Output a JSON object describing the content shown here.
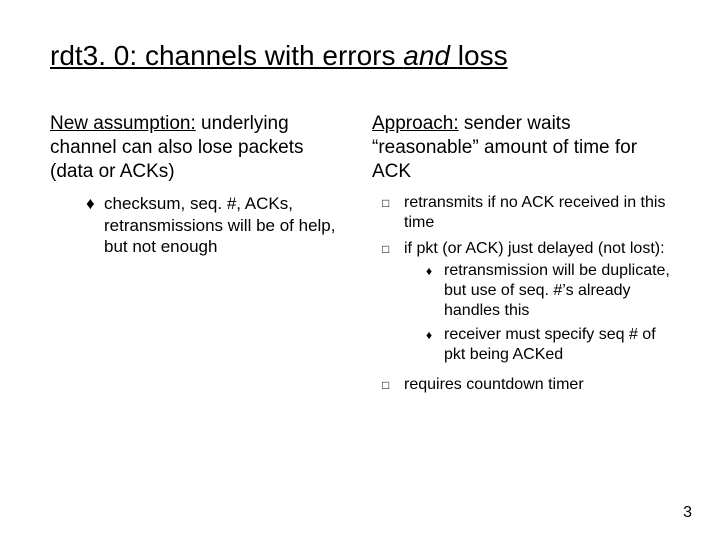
{
  "title_prefix": "rdt3. 0: channels with errors ",
  "title_italic": "and ",
  "title_suffix": "loss",
  "left": {
    "lead": "New assumption:",
    "body": " underlying channel can also lose packets (data or ACKs)",
    "sub1": "checksum, seq. #, ACKs, retransmissions will be of help, but not enough"
  },
  "right": {
    "lead": "Approach:",
    "body": " sender waits “reasonable” amount of time for ACK",
    "b1": "retransmits if no ACK received in this time",
    "b2": "if pkt (or ACK) just delayed (not lost):",
    "b2a": "retransmission will be duplicate, but use of seq. #’s already handles this",
    "b2b": "receiver must specify seq # of pkt being ACKed",
    "b3": "requires countdown timer"
  },
  "page": "3",
  "marks": {
    "diamond": "♦",
    "box": "□"
  }
}
